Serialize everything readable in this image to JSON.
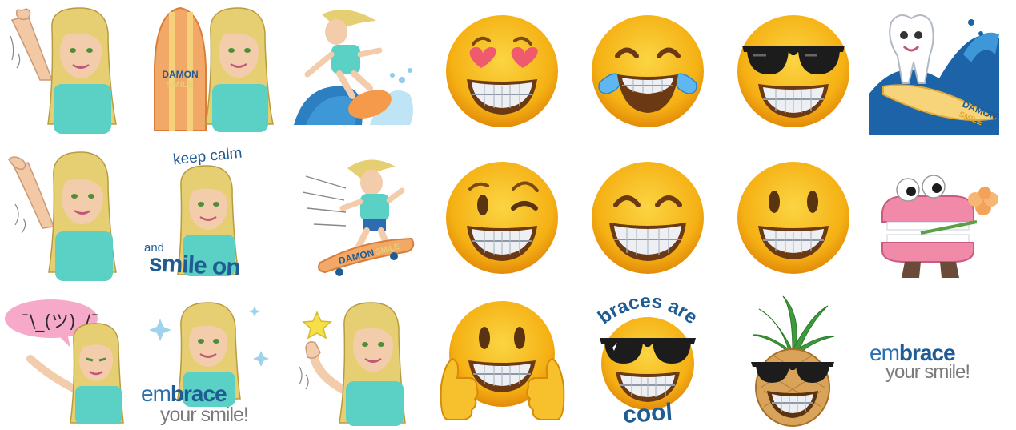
{
  "grid": {
    "rows": 3,
    "columns": 7
  },
  "colors": {
    "emoji_yellow": "#F7B90F",
    "emoji_orange": "#E98F0A",
    "hair_blonde": "#E6CF72",
    "shirt_teal": "#5BD0C4",
    "brand_blue": "#1F5C93",
    "heart_pink": "#F05A6E",
    "speech_pink": "#F6A9C8",
    "wave_blue": "#2C7FC1",
    "braces_grey": "#D9DDE3"
  },
  "stickers": {
    "r1c1": {
      "name": "woman-waving"
    },
    "r1c2": {
      "name": "woman-with-surfboard",
      "board_text_1": "DAMON",
      "board_text_2": "SMILE"
    },
    "r1c3": {
      "name": "woman-surfing-wave"
    },
    "r1c4": {
      "name": "heart-eyes-braces-emoji"
    },
    "r1c5": {
      "name": "tears-of-joy-braces-emoji"
    },
    "r1c6": {
      "name": "sunglasses-braces-emoji"
    },
    "r1c7": {
      "name": "tooth-surfing-wave",
      "board_text_1": "DAMON",
      "board_text_2": "SMILE"
    },
    "r2c1": {
      "name": "woman-shaka-wave"
    },
    "r2c2": {
      "name": "keep-calm-smile-on",
      "line1": "keep calm",
      "line2": "and",
      "line3": "smile on"
    },
    "r2c3": {
      "name": "woman-skateboarding",
      "board_text_1": "DAMON",
      "board_text_2": "SMILE"
    },
    "r2c4": {
      "name": "winking-braces-emoji"
    },
    "r2c5": {
      "name": "grinning-squint-braces-emoji"
    },
    "r2c6": {
      "name": "smiling-braces-emoji"
    },
    "r2c7": {
      "name": "chattering-teeth-with-flower"
    },
    "r3c1": {
      "name": "woman-shrug-speech-bubble",
      "bubble": "¯\\_(ツ)_/¯"
    },
    "r3c2": {
      "name": "woman-embrace-your-smile",
      "word_em": "em",
      "word_brace": "brace",
      "line2": "your smile!"
    },
    "r3c3": {
      "name": "woman-thumbs-up-star"
    },
    "r3c4": {
      "name": "thumbs-up-braces-emoji"
    },
    "r3c5": {
      "name": "braces-are-cool-emoji",
      "arc_top": "braces are",
      "arc_bottom": "cool"
    },
    "r3c6": {
      "name": "pineapple-sunglasses-braces"
    },
    "r3c7": {
      "name": "embrace-your-smile-logo",
      "word_em": "em",
      "word_brace": "brace",
      "line2": "your smile!"
    }
  }
}
